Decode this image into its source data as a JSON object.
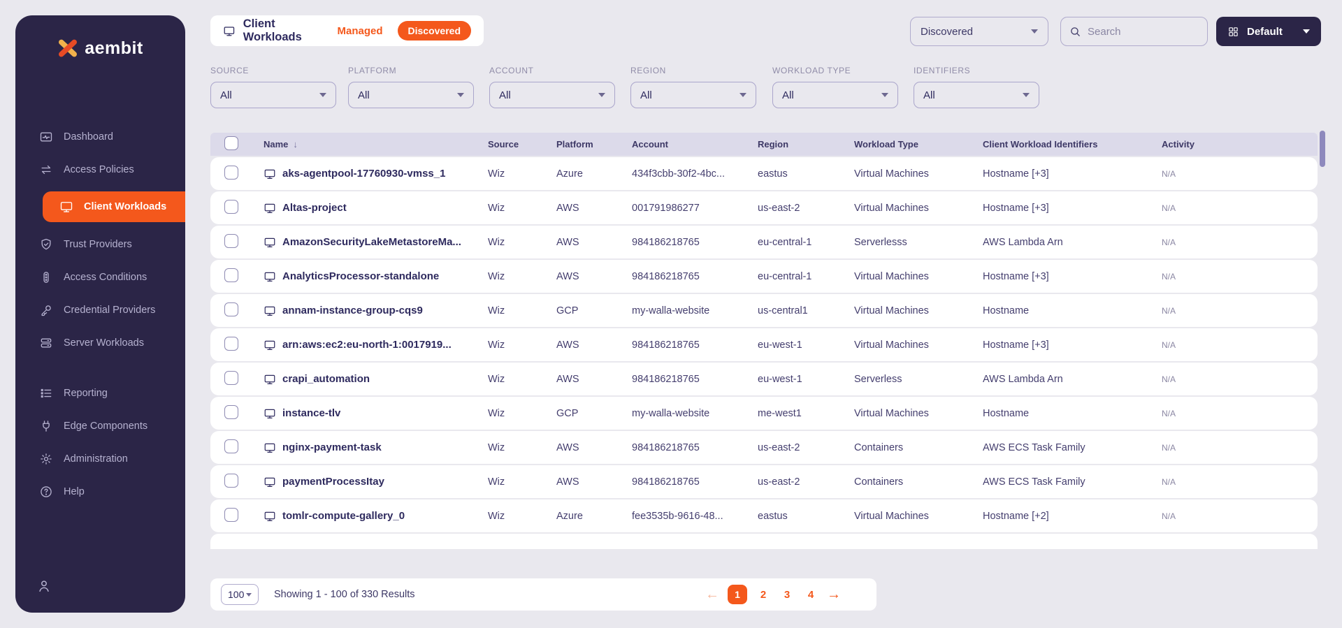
{
  "brand": {
    "logo_text": "aembit",
    "logo_mark_icon": "aembit-x-icon"
  },
  "colors": {
    "accent": "#f4581c",
    "sidebar_bg": "#2b2547",
    "page_bg": "#e9e8ee",
    "table_header_bg": "#dcdaea",
    "navy_text": "#2e2a5e"
  },
  "sidebar": {
    "items": [
      {
        "label": "Dashboard",
        "icon": "dashboard-icon",
        "active": false
      },
      {
        "label": "Access Policies",
        "icon": "access-policies-icon",
        "active": false
      },
      {
        "label": "Client Workloads",
        "icon": "client-workloads-icon",
        "active": true
      },
      {
        "label": "Trust Providers",
        "icon": "trust-providers-icon",
        "active": false
      },
      {
        "label": "Access Conditions",
        "icon": "access-conditions-icon",
        "active": false
      },
      {
        "label": "Credential Providers",
        "icon": "credential-providers-icon",
        "active": false
      },
      {
        "label": "Server Workloads",
        "icon": "server-workloads-icon",
        "active": false
      },
      {
        "label": "Reporting",
        "icon": "reporting-icon",
        "active": false
      },
      {
        "label": "Edge Components",
        "icon": "edge-components-icon",
        "active": false
      },
      {
        "label": "Administration",
        "icon": "administration-icon",
        "active": false
      },
      {
        "label": "Help",
        "icon": "help-icon",
        "active": false
      }
    ],
    "footer_icon": "user-icon"
  },
  "header": {
    "title": "Client Workloads",
    "title_icon": "monitor-icon",
    "tab_managed": "Managed",
    "tab_discovered": "Discovered",
    "view_select_value": "Discovered",
    "search_placeholder": "Search",
    "layout_button_label": "Default",
    "layout_button_icon": "grid-icon"
  },
  "filters": [
    {
      "label": "SOURCE",
      "value": "All"
    },
    {
      "label": "PLATFORM",
      "value": "All"
    },
    {
      "label": "ACCOUNT",
      "value": "All"
    },
    {
      "label": "REGION",
      "value": "All"
    },
    {
      "label": "WORKLOAD TYPE",
      "value": "All"
    },
    {
      "label": "IDENTIFIERS",
      "value": "All"
    }
  ],
  "table": {
    "columns": [
      "Name",
      "Source",
      "Platform",
      "Account",
      "Region",
      "Workload Type",
      "Client Workload Identifiers",
      "Activity"
    ],
    "sort_column": "Name",
    "sort_icon": "sort-desc-icon",
    "row_icon": "monitor-icon",
    "rows": [
      {
        "name": "aks-agentpool-17760930-vmss_1",
        "source": "Wiz",
        "platform": "Azure",
        "account": "434f3cbb-30f2-4bc...",
        "region": "eastus",
        "workload_type": "Virtual Machines",
        "identifiers": "Hostname [+3]",
        "activity": "N/A"
      },
      {
        "name": "Altas-project",
        "source": "Wiz",
        "platform": "AWS",
        "account": "001791986277",
        "region": "us-east-2",
        "workload_type": "Virtual Machines",
        "identifiers": "Hostname [+3]",
        "activity": "N/A"
      },
      {
        "name": "AmazonSecurityLakeMetastoreMa...",
        "source": "Wiz",
        "platform": "AWS",
        "account": "984186218765",
        "region": "eu-central-1",
        "workload_type": "Serverlesss",
        "identifiers": "AWS Lambda Arn",
        "activity": "N/A"
      },
      {
        "name": "AnalyticsProcessor-standalone",
        "source": "Wiz",
        "platform": "AWS",
        "account": "984186218765",
        "region": "eu-central-1",
        "workload_type": "Virtual Machines",
        "identifiers": "Hostname [+3]",
        "activity": "N/A"
      },
      {
        "name": "annam-instance-group-cqs9",
        "source": "Wiz",
        "platform": "GCP",
        "account": "my-walla-website",
        "region": "us-central1",
        "workload_type": "Virtual Machines",
        "identifiers": "Hostname",
        "activity": "N/A"
      },
      {
        "name": "arn:aws:ec2:eu-north-1:0017919...",
        "source": "Wiz",
        "platform": "AWS",
        "account": "984186218765",
        "region": "eu-west-1",
        "workload_type": "Virtual Machines",
        "identifiers": "Hostname [+3]",
        "activity": "N/A"
      },
      {
        "name": "crapi_automation",
        "source": "Wiz",
        "platform": "AWS",
        "account": "984186218765",
        "region": "eu-west-1",
        "workload_type": "Serverless",
        "identifiers": "AWS Lambda Arn",
        "activity": "N/A"
      },
      {
        "name": "instance-tlv",
        "source": "Wiz",
        "platform": "GCP",
        "account": "my-walla-website",
        "region": "me-west1",
        "workload_type": "Virtual Machines",
        "identifiers": "Hostname",
        "activity": "N/A"
      },
      {
        "name": "nginx-payment-task",
        "source": "Wiz",
        "platform": "AWS",
        "account": "984186218765",
        "region": "us-east-2",
        "workload_type": "Containers",
        "identifiers": "AWS ECS Task Family",
        "activity": "N/A"
      },
      {
        "name": "paymentProcessItay",
        "source": "Wiz",
        "platform": "AWS",
        "account": "984186218765",
        "region": "us-east-2",
        "workload_type": "Containers",
        "identifiers": "AWS ECS Task Family",
        "activity": "N/A"
      },
      {
        "name": "tomlr-compute-gallery_0",
        "source": "Wiz",
        "platform": "Azure",
        "account": "fee3535b-9616-48...",
        "region": "eastus",
        "workload_type": "Virtual Machines",
        "identifiers": "Hostname [+2]",
        "activity": "N/A"
      }
    ]
  },
  "pagination": {
    "page_size": "100",
    "summary": "Showing 1 - 100 of 330 Results",
    "pages": [
      "1",
      "2",
      "3",
      "4"
    ],
    "active_page": "1",
    "prev_icon": "arrow-left-icon",
    "next_icon": "arrow-right-icon"
  }
}
